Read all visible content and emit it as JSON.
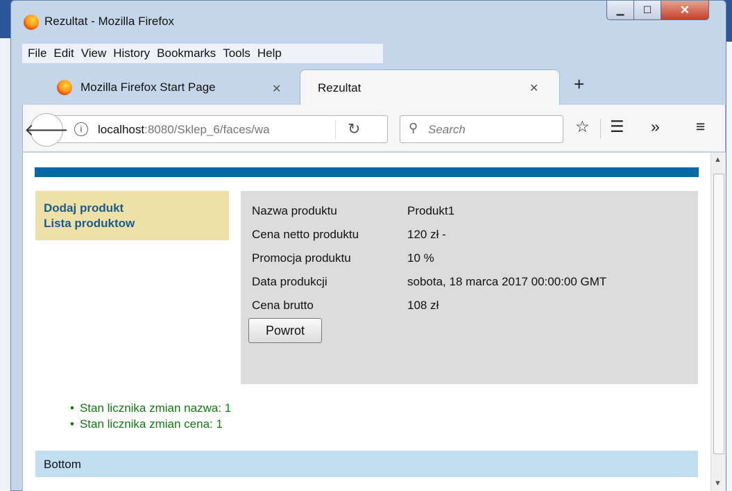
{
  "window": {
    "title": "Rezultat - Mozilla Firefox"
  },
  "menu": [
    "File",
    "Edit",
    "View",
    "History",
    "Bookmarks",
    "Tools",
    "Help"
  ],
  "tabs": [
    {
      "label": "Mozilla Firefox Start Page",
      "active": false
    },
    {
      "label": "Rezultat",
      "active": true
    }
  ],
  "navbar": {
    "url_host": "localhost",
    "url_rest": ":8080/Sklep_6/faces/wa",
    "search_placeholder": "Search"
  },
  "leftmenu": [
    "Dodaj produkt",
    "Lista produktow"
  ],
  "product": {
    "rows": [
      {
        "label": "Nazwa produktu",
        "value": "Produkt1"
      },
      {
        "label": "Cena netto produktu",
        "value": "120 zł -"
      },
      {
        "label": "Promocja produktu",
        "value": "10 %"
      },
      {
        "label": "Data produkcji",
        "value": "sobota, 18 marca 2017 00:00:00 GMT"
      },
      {
        "label": "Cena brutto",
        "value": "108 zł"
      }
    ],
    "button": "Powrot"
  },
  "counters": [
    "Stan licznika zmian nazwa: 1",
    "Stan licznika zmian cena: 1"
  ],
  "footer": "Bottom",
  "colors": {
    "topbar": "#0068a3",
    "leftmenu": "#ede1a7",
    "content": "#dcdcdc",
    "footer": "#c1dff0",
    "counters": "#0f7a0f"
  }
}
